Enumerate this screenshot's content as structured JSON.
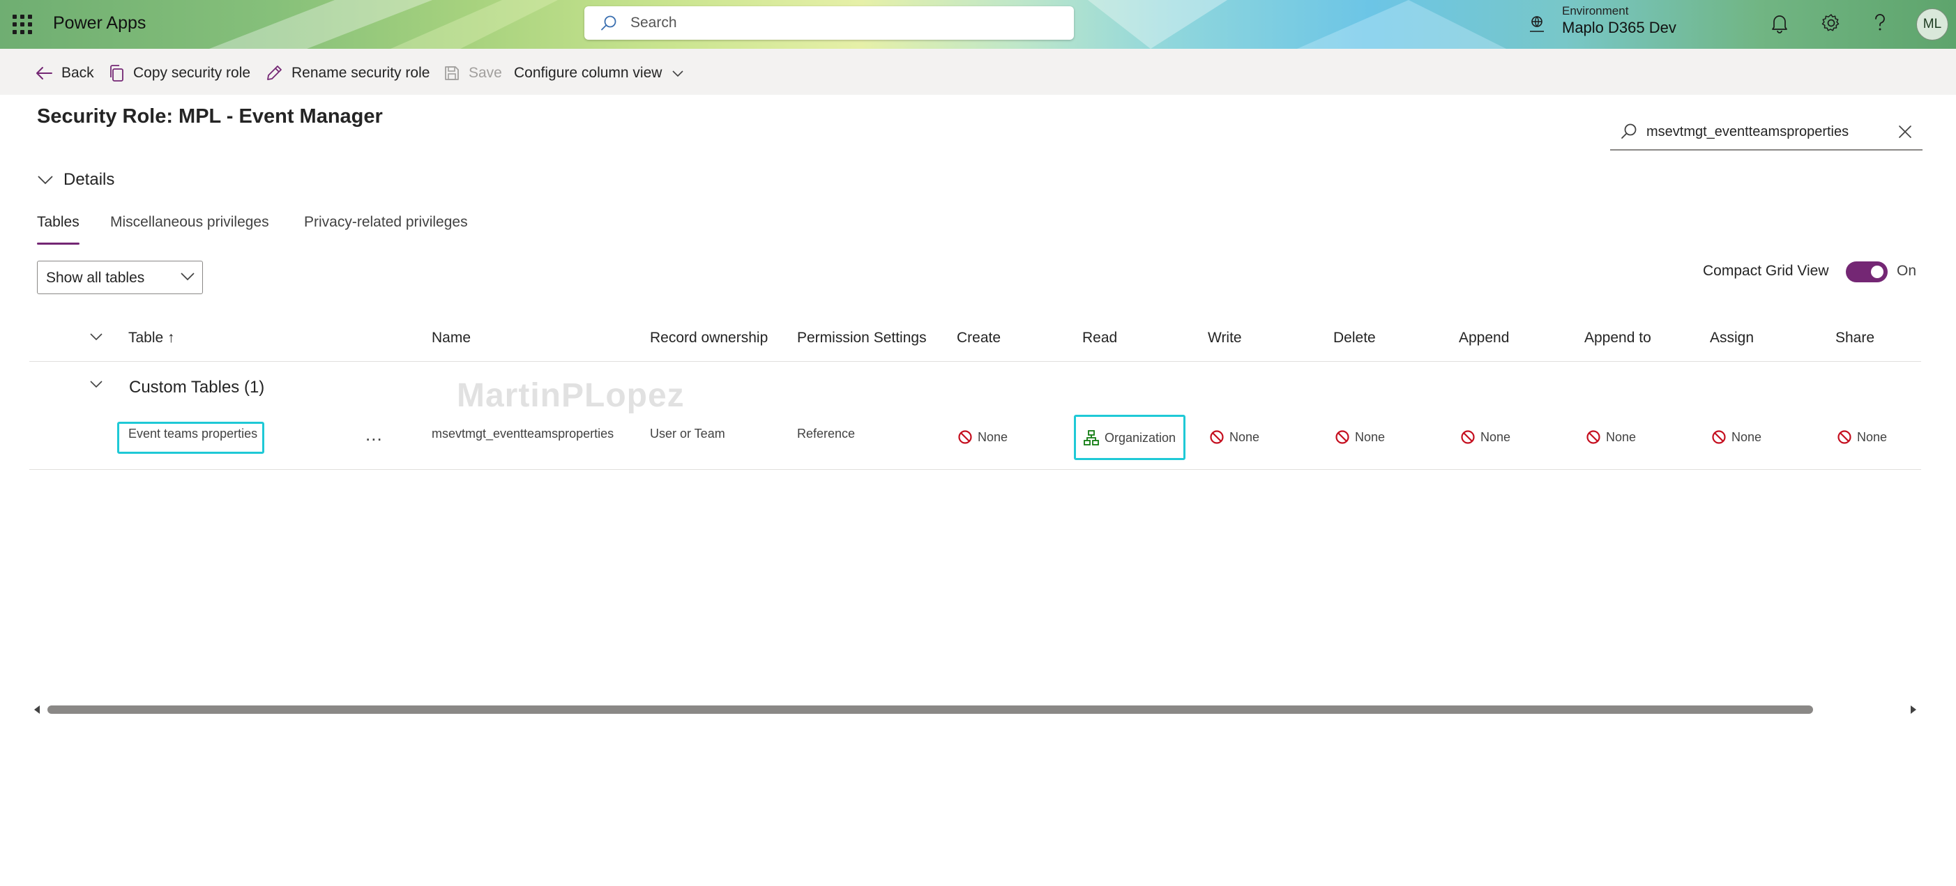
{
  "header": {
    "app_name": "Power Apps",
    "search_placeholder": "Search",
    "environment_label": "Environment",
    "environment_name": "Maplo D365 Dev",
    "avatar_initials": "ML"
  },
  "commands": {
    "back": "Back",
    "copy": "Copy security role",
    "rename": "Rename security role",
    "save": "Save",
    "configure": "Configure column view"
  },
  "page": {
    "title": "Security Role: MPL - Event Manager",
    "search_value": "msevtmgt_eventteamsproperties"
  },
  "details_label": "Details",
  "tabs": [
    {
      "label": "Tables",
      "active": true
    },
    {
      "label": "Miscellaneous privileges",
      "active": false
    },
    {
      "label": "Privacy-related privileges",
      "active": false
    }
  ],
  "filter_dropdown": "Show all tables",
  "compact_grid": {
    "label": "Compact Grid View",
    "state": "On"
  },
  "grid": {
    "columns": {
      "table": "Table ↑",
      "name": "Name",
      "record_ownership": "Record ownership",
      "permission_settings": "Permission Settings",
      "create": "Create",
      "read": "Read",
      "write": "Write",
      "delete": "Delete",
      "append": "Append",
      "append_to": "Append to",
      "assign": "Assign",
      "share": "Share"
    },
    "group": "Custom Tables (1)",
    "watermark": "MartinPLopez",
    "row": {
      "table": "Event teams properties",
      "more": "...",
      "name": "msevtmgt_eventteamsproperties",
      "record_ownership": "User or Team",
      "permission_settings": "Reference",
      "create": "None",
      "read": "Organization",
      "write": "None",
      "delete": "None",
      "append": "None",
      "append_to": "None",
      "assign": "None",
      "share": "None"
    }
  },
  "colors": {
    "accent": "#742774",
    "highlight": "#1fc9d6",
    "none_icon": "#c50f1f",
    "org_icon": "#107c10"
  }
}
